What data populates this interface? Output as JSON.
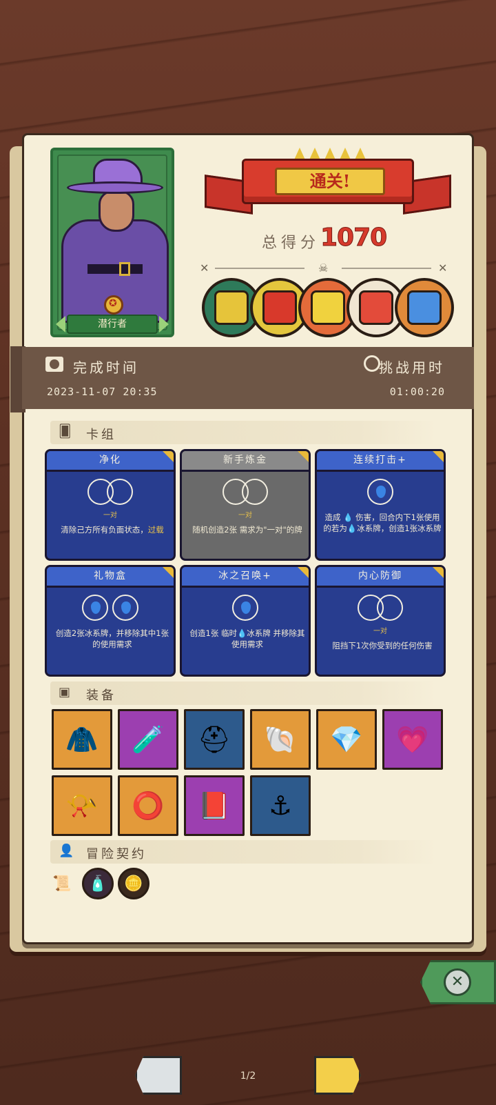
{
  "character": {
    "name": "潜行者"
  },
  "result": {
    "banner": "通关!",
    "score_label": "总得分",
    "score": "1070"
  },
  "bosses": [
    {
      "icon": "armored-knight-boss-icon",
      "bg": "#2e7a5a",
      "fg": "#e6c43a"
    },
    {
      "icon": "red-demon-boss-icon",
      "bg": "#e4c63d",
      "fg": "#d8392b"
    },
    {
      "icon": "cyclops-boss-icon",
      "bg": "#e46b3a",
      "fg": "#f0d23e"
    },
    {
      "icon": "tribal-mask-boss-icon",
      "bg": "#f0e6d2",
      "fg": "#e34b3a"
    },
    {
      "icon": "crystal-golem-boss-icon",
      "bg": "#e08a3a",
      "fg": "#4a8fe0"
    }
  ],
  "time": {
    "finish_label": "完成时间",
    "finish_value": "2023-11-07 20:35",
    "challenge_label": "挑战用时",
    "challenge_value": "01:00:20"
  },
  "sections": {
    "deck": "卡组",
    "equipment": "装备",
    "contract": "冒险契约"
  },
  "cards": [
    {
      "title": "净化",
      "style": "blue",
      "symbol": "pair",
      "sub": "一对",
      "desc": "清除己方所有负面状态，",
      "desc_hl": "过载"
    },
    {
      "title": "新手炼金",
      "style": "gray",
      "symbol": "pair",
      "sub": "一对",
      "desc": "随机创造2张 需求为\"一对\"的牌",
      "desc_hl": ""
    },
    {
      "title": "连续打击+",
      "style": "blue",
      "symbol": "drop",
      "sub": "",
      "desc": "造成 💧 伤害，回合内下1张使用的若为💧冰系牌，创造1张冰系牌",
      "desc_hl": ""
    },
    {
      "title": "礼物盒",
      "style": "blue",
      "symbol": "drop2",
      "sub": "",
      "desc": "创造2张冰系牌，并移除其中1张的使用需求",
      "desc_hl": ""
    },
    {
      "title": "冰之召唤+",
      "style": "blue",
      "symbol": "drop",
      "sub": "",
      "desc": "创造1张 临时💧冰系牌 并移除其使用需求",
      "desc_hl": ""
    },
    {
      "title": "内心防御",
      "style": "blue",
      "symbol": "pair",
      "sub": "一对",
      "desc": "阻挡下1次你受到的任何伤害",
      "desc_hl": ""
    }
  ],
  "equipment": [
    {
      "icon": "sweater-icon",
      "bg": "#e39a3a",
      "glyph": "🧥"
    },
    {
      "icon": "purple-potion-icon",
      "bg": "#9c3fb0",
      "glyph": "🧪"
    },
    {
      "icon": "golden-helmet-icon",
      "bg": "#2d5a8c",
      "glyph": "⛑"
    },
    {
      "icon": "green-shell-icon",
      "bg": "#e39a3a",
      "glyph": "🐚"
    },
    {
      "icon": "blue-crystal-icon",
      "bg": "#e39a3a",
      "glyph": "💎"
    },
    {
      "icon": "heart-pendant-icon",
      "bg": "#9c3fb0",
      "glyph": "💗"
    },
    {
      "icon": "horn-icon",
      "bg": "#e39a3a",
      "glyph": "📯"
    },
    {
      "icon": "spiked-bracelet-icon",
      "bg": "#e39a3a",
      "glyph": "⭕"
    },
    {
      "icon": "golden-book-icon",
      "bg": "#9c3fb0",
      "glyph": "📕"
    },
    {
      "icon": "anchor-hook-icon",
      "bg": "#2d5a8c",
      "glyph": "⚓"
    }
  ],
  "contracts": [
    {
      "icon": "scroll-icon",
      "bg": "#f6efd9",
      "glyph": "📜"
    },
    {
      "icon": "bottle-icon",
      "bg": "#3b2a3a",
      "glyph": "🧴"
    },
    {
      "icon": "gold-coin-icon",
      "bg": "#3b2a1e",
      "glyph": "🪙"
    }
  ],
  "nav": {
    "page": "1/2"
  }
}
